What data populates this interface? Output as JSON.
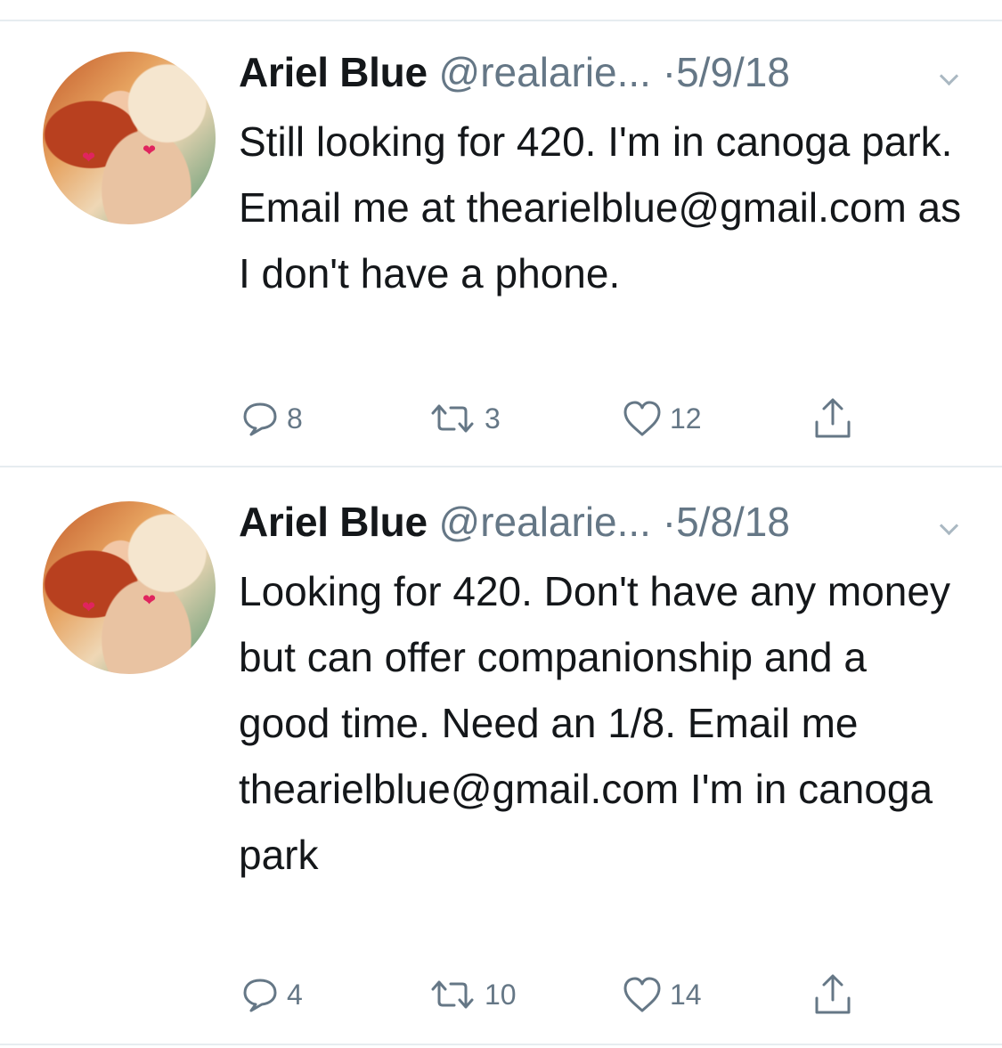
{
  "tweets": [
    {
      "author_name": "Ariel Blue",
      "handle": "@realarie...",
      "separator": "·",
      "date": "5/9/18",
      "text": "Still looking for 420. I'm in canoga park. Email me at thearielblue@gmail.com as I don't have a phone.",
      "replies": "8",
      "retweets": "3",
      "likes": "12",
      "icons": [
        "reply-icon",
        "retweet-icon",
        "like-icon",
        "share-icon"
      ]
    },
    {
      "author_name": "Ariel Blue",
      "handle": "@realarie...",
      "separator": "·",
      "date": "5/8/18",
      "text": "Looking for 420. Don't have any money but can offer companionship and a good time. Need an 1/8. Email me thearielblue@gmail.com I'm in canoga park",
      "replies": "4",
      "retweets": "10",
      "likes": "14",
      "icons": [
        "reply-icon",
        "retweet-icon",
        "like-icon",
        "share-icon"
      ]
    }
  ],
  "colors": {
    "text_primary": "#14171a",
    "text_secondary": "#657786",
    "divider": "#e6ecf0",
    "caret": "#aab8c2"
  }
}
